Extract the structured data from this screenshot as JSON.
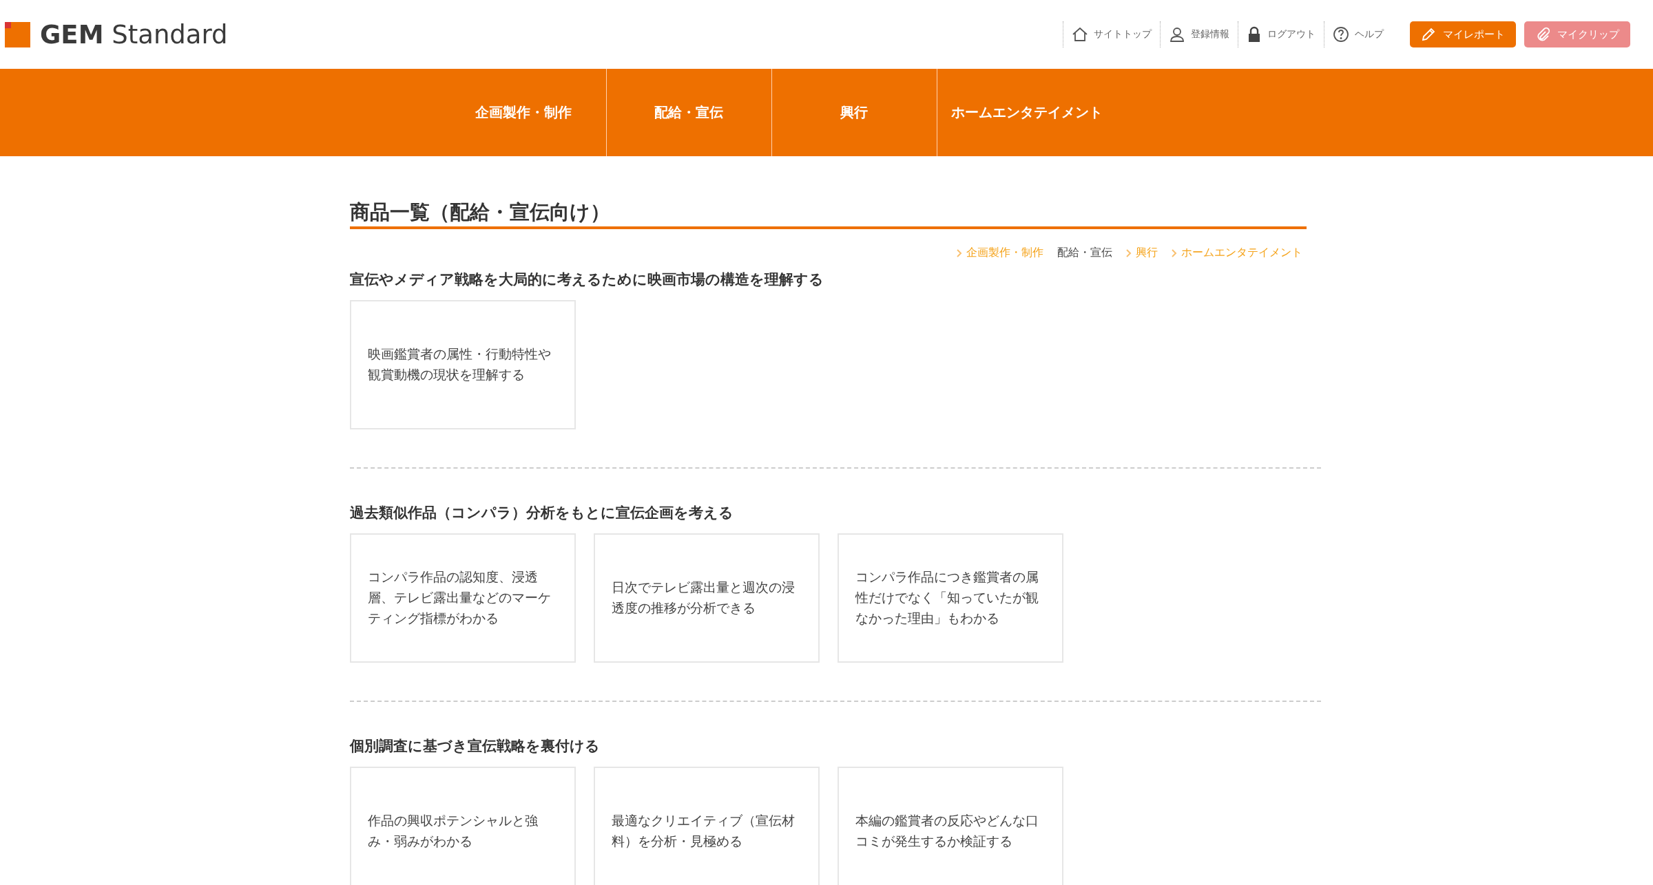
{
  "logo": {
    "bold": "GEM",
    "light": "Standard"
  },
  "top_links": [
    {
      "kind": "home",
      "label": "サイトトップ"
    },
    {
      "kind": "user",
      "label": "登録情報"
    },
    {
      "kind": "lock",
      "label": "ログアウト"
    },
    {
      "kind": "help",
      "label": "ヘルプ"
    }
  ],
  "top_buttons": [
    {
      "kind": "report",
      "label": "マイレポート"
    },
    {
      "kind": "clip",
      "label": "マイクリップ"
    }
  ],
  "main_nav": [
    "企画製作・制作",
    "配給・宣伝",
    "興行",
    "ホームエンタテイメント"
  ],
  "page_title": "商品一覧（配給・宣伝向け）",
  "breadcrumb": [
    {
      "label": "企画製作・制作",
      "selected": false
    },
    {
      "label": "配給・宣伝",
      "selected": true
    },
    {
      "label": "興行",
      "selected": false
    },
    {
      "label": "ホームエンタテイメント",
      "selected": false
    }
  ],
  "sections": [
    {
      "heading": "宣伝やメディア戦略を大局的に考えるために映画市場の構造を理解する",
      "cards": [
        "映画鑑賞者の属性・行動特性や観賞動機の現状を理解する"
      ]
    },
    {
      "heading": "過去類似作品（コンパラ）分析をもとに宣伝企画を考える",
      "cards": [
        "コンパラ作品の認知度、浸透層、テレビ露出量などのマーケティング指標がわかる",
        "日次でテレビ露出量と週次の浸透度の推移が分析できる",
        "コンパラ作品につき鑑賞者の属性だけでなく「知っていたが観なかった理由」もわかる"
      ]
    },
    {
      "heading": "個別調査に基づき宣伝戦略を裏付ける",
      "cards": [
        "作品の興収ポテンシャルと強み・弱みがわかる",
        "最適なクリエイティブ（宣伝材料）を分析・見極める",
        "本編の鑑賞者の反応やどんな口コミが発生するか検証する"
      ]
    }
  ]
}
